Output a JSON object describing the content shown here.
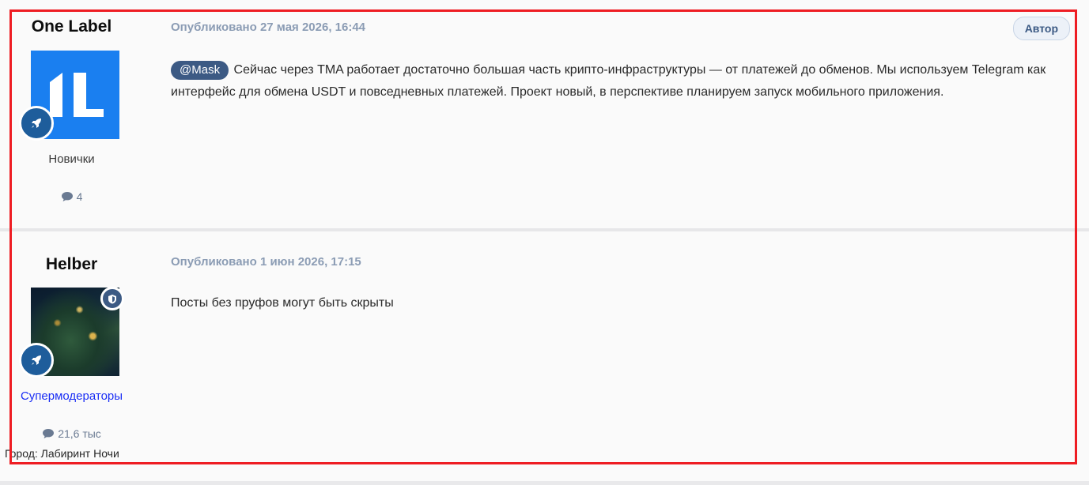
{
  "posts": [
    {
      "author": "One Label",
      "posted": "Опубликовано 27 мая 2026, 16:44",
      "author_badge": "Автор",
      "group": "Новички",
      "group_color": "#3a3a3a",
      "post_count": "4",
      "mention": "@Mask",
      "content": "Сейчас через TMA работает достаточно большая часть крипто-инфраструктуры — от платежей до обменов. Мы используем Telegram как интерфейс для обмена USDT и повседневных платежей. Проект новый, в перспективе планируем запуск мобильного приложения."
    },
    {
      "author": "Helber",
      "posted": "Опубликовано 1 июн 2026, 17:15",
      "group": "Супермодераторы",
      "group_color": "#1a2ef5",
      "post_count": "21,6 тыс",
      "content": "Посты без пруфов могут быть скрыты",
      "city": "Город: Лабиринт Ночи"
    }
  ],
  "icons": {
    "rocket": "rocket-icon",
    "shield": "shield-icon",
    "comment": "comment-icon"
  },
  "colors": {
    "highlight_border": "#ee1d23",
    "accent": "#3c5a84",
    "avatar_blue": "#1a7ff0"
  }
}
